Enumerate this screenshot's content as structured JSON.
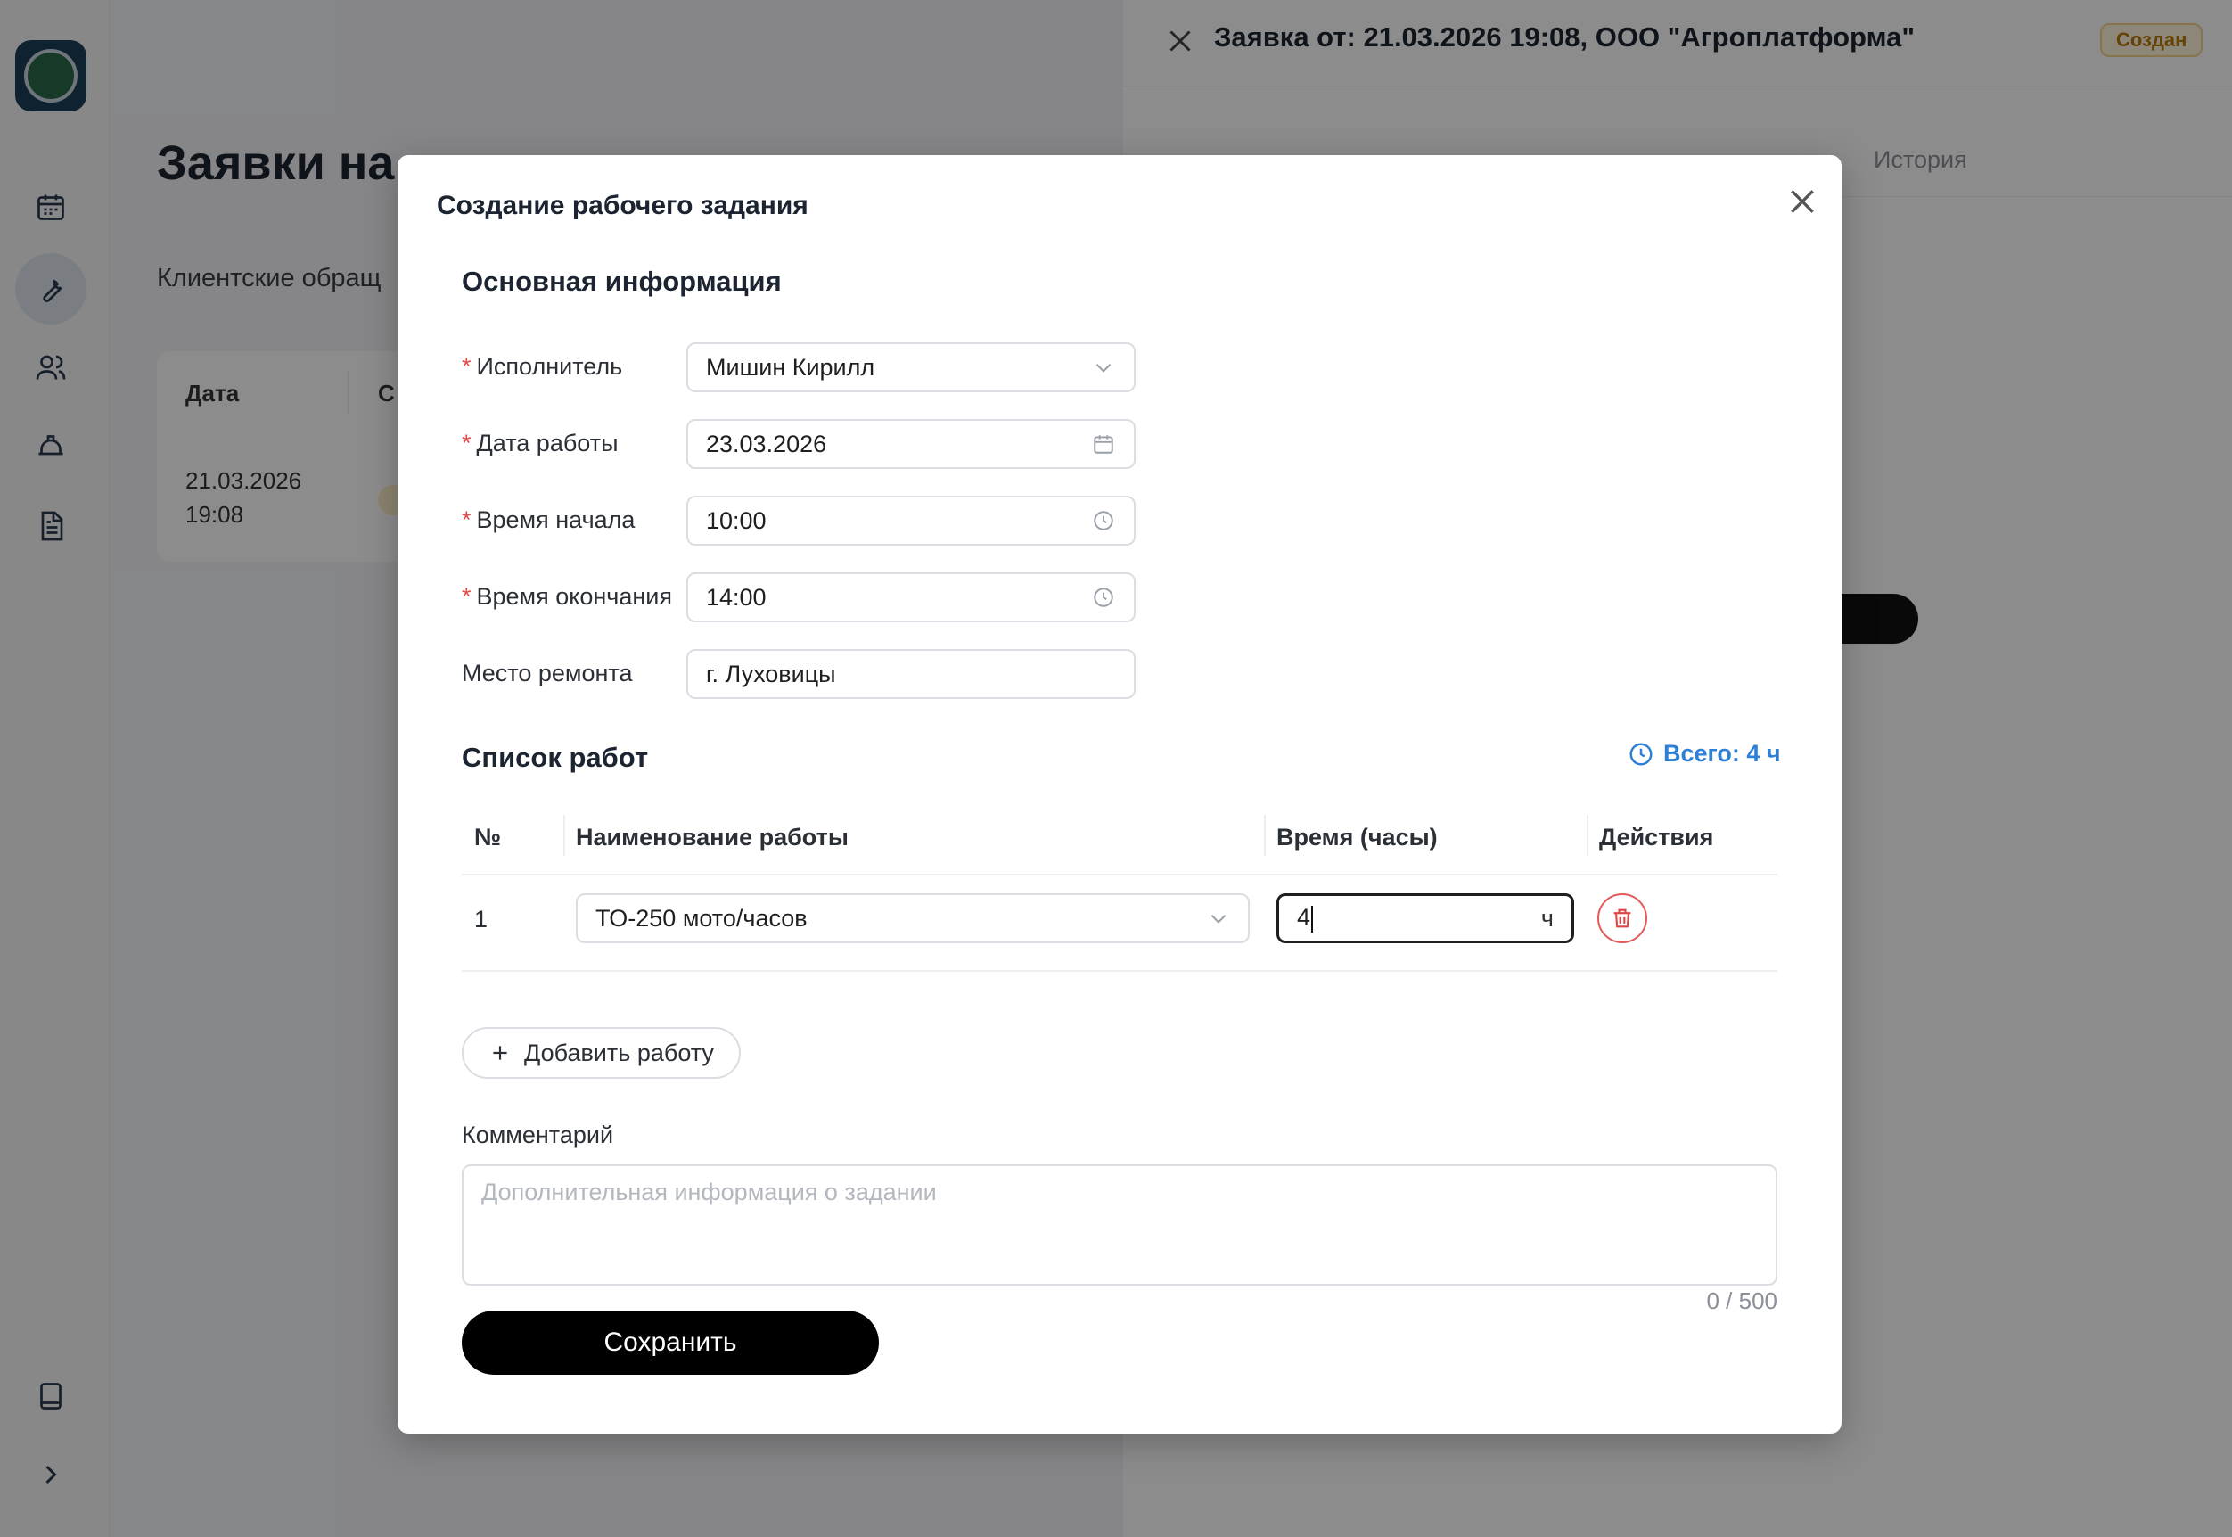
{
  "main": {
    "title": "Заявки на",
    "subtitle": "Клиентские обращ",
    "table": {
      "col_date": "Дата",
      "col_status": "С",
      "row_date": "21.03.2026\n19:08"
    }
  },
  "panel": {
    "title": "Заявка от: 21.03.2026 19:08, ООО \"Агроплатформа\"",
    "status": "Создан",
    "tabs": [
      "История"
    ]
  },
  "modal": {
    "title": "Создание рабочего задания",
    "basic_section": "Основная информация",
    "fields": {
      "executor": {
        "label": "Исполнитель",
        "value": "Мишин Кирилл"
      },
      "work_date": {
        "label": "Дата работы",
        "value": "23.03.2026"
      },
      "start_time": {
        "label": "Время начала",
        "value": "10:00"
      },
      "end_time": {
        "label": "Время окончания",
        "value": "14:00"
      },
      "location": {
        "label": "Место ремонта",
        "value": "г. Луховицы"
      }
    },
    "works_section": "Список работ",
    "total": "Всего: 4 ч",
    "table": {
      "headers": [
        "№",
        "Наименование работы",
        "Время (часы)",
        "Действия"
      ],
      "rows": [
        {
          "num": "1",
          "name": "ТО-250 мото/часов",
          "hours": "4",
          "unit": "ч"
        }
      ]
    },
    "add_work": "Добавить работу",
    "comment_label": "Комментарий",
    "comment_placeholder": "Дополнительная информация о задании",
    "counter": "0 / 500",
    "save": "Сохранить"
  },
  "colors": {
    "accent_blue": "#2e7fd6",
    "required": "#e24b4b",
    "status_badge": "#b9780a",
    "primary_button": "#000000"
  }
}
